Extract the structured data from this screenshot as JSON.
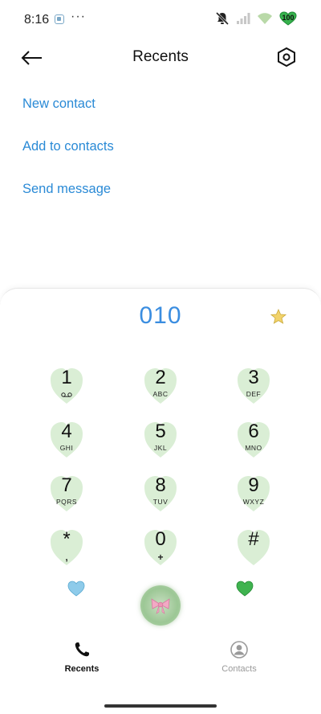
{
  "status_bar": {
    "time": "8:16",
    "dots": "···",
    "battery": "100",
    "icons": [
      "app-notification-icon",
      "mute-icon",
      "signal-icon",
      "wifi-icon",
      "battery-heart-icon"
    ]
  },
  "header": {
    "title": "Recents",
    "back_icon": "arrow-left-icon",
    "settings_icon": "hexagon-settings-icon"
  },
  "actions": {
    "new_contact": "New contact",
    "add_to_contacts": "Add to contacts",
    "send_message": "Send message"
  },
  "dialer": {
    "number": "010",
    "keys": [
      {
        "digit": "1",
        "letters": "",
        "icon": "voicemail-icon"
      },
      {
        "digit": "2",
        "letters": "ABC"
      },
      {
        "digit": "3",
        "letters": "DEF"
      },
      {
        "digit": "4",
        "letters": "GHI"
      },
      {
        "digit": "5",
        "letters": "JKL"
      },
      {
        "digit": "6",
        "letters": "MNO"
      },
      {
        "digit": "7",
        "letters": "PQRS"
      },
      {
        "digit": "8",
        "letters": "TUV"
      },
      {
        "digit": "9",
        "letters": "WXYZ"
      },
      {
        "digit": "*",
        "letters": ","
      },
      {
        "digit": "0",
        "letters": "+"
      },
      {
        "digit": "#",
        "letters": ""
      }
    ]
  },
  "nav": {
    "recents": "Recents",
    "contacts": "Contacts"
  },
  "colors": {
    "accent": "#2a8ad6",
    "number": "#3a8de0",
    "key_heart": "#cfe8c8",
    "left_heart": "#8ecbea",
    "right_heart": "#3fb34f",
    "call_button": "#a8cf9f"
  }
}
